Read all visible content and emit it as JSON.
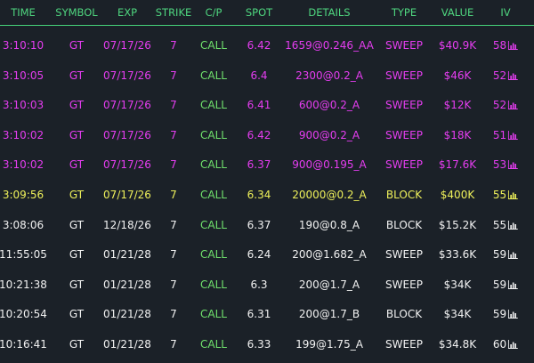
{
  "colors": {
    "background": "#1b2128",
    "header_text": "#4fd67f",
    "header_line": "#46d37a",
    "sweep_magenta": "#e53df0",
    "block_yellow": "#eef05a",
    "call_green": "#6fe06c",
    "white": "#f2f2f2"
  },
  "headers": [
    "TIME",
    "SYMBOL",
    "EXP",
    "STRIKE",
    "C/P",
    "SPOT",
    "DETAILS",
    "TYPE",
    "VALUE",
    "IV"
  ],
  "rows": [
    {
      "time": "3:10:10",
      "symbol": "GT",
      "exp": "07/17/26",
      "strike": "7",
      "cp": "CALL",
      "spot": "6.42",
      "details": "1659@0.246_AA",
      "type": "SWEEP",
      "value": "$40.9K",
      "iv": "58",
      "color": "magenta"
    },
    {
      "time": "3:10:05",
      "symbol": "GT",
      "exp": "07/17/26",
      "strike": "7",
      "cp": "CALL",
      "spot": "6.4",
      "details": "2300@0.2_A",
      "type": "SWEEP",
      "value": "$46K",
      "iv": "52",
      "color": "magenta"
    },
    {
      "time": "3:10:03",
      "symbol": "GT",
      "exp": "07/17/26",
      "strike": "7",
      "cp": "CALL",
      "spot": "6.41",
      "details": "600@0.2_A",
      "type": "SWEEP",
      "value": "$12K",
      "iv": "52",
      "color": "magenta"
    },
    {
      "time": "3:10:02",
      "symbol": "GT",
      "exp": "07/17/26",
      "strike": "7",
      "cp": "CALL",
      "spot": "6.42",
      "details": "900@0.2_A",
      "type": "SWEEP",
      "value": "$18K",
      "iv": "51",
      "color": "magenta"
    },
    {
      "time": "3:10:02",
      "symbol": "GT",
      "exp": "07/17/26",
      "strike": "7",
      "cp": "CALL",
      "spot": "6.37",
      "details": "900@0.195_A",
      "type": "SWEEP",
      "value": "$17.6K",
      "iv": "53",
      "color": "magenta"
    },
    {
      "time": "3:09:56",
      "symbol": "GT",
      "exp": "07/17/26",
      "strike": "7",
      "cp": "CALL",
      "spot": "6.34",
      "details": "20000@0.2_A",
      "type": "BLOCK",
      "value": "$400K",
      "iv": "55",
      "color": "yellow"
    },
    {
      "time": "3:08:06",
      "symbol": "GT",
      "exp": "12/18/26",
      "strike": "7",
      "cp": "CALL",
      "spot": "6.37",
      "details": "190@0.8_A",
      "type": "BLOCK",
      "value": "$15.2K",
      "iv": "55",
      "color": "white"
    },
    {
      "time": "11:55:05",
      "symbol": "GT",
      "exp": "01/21/28",
      "strike": "7",
      "cp": "CALL",
      "spot": "6.24",
      "details": "200@1.682_A",
      "type": "SWEEP",
      "value": "$33.6K",
      "iv": "59",
      "color": "white"
    },
    {
      "time": "10:21:38",
      "symbol": "GT",
      "exp": "01/21/28",
      "strike": "7",
      "cp": "CALL",
      "spot": "6.3",
      "details": "200@1.7_A",
      "type": "SWEEP",
      "value": "$34K",
      "iv": "59",
      "color": "white"
    },
    {
      "time": "10:20:54",
      "symbol": "GT",
      "exp": "01/21/28",
      "strike": "7",
      "cp": "CALL",
      "spot": "6.31",
      "details": "200@1.7_B",
      "type": "BLOCK",
      "value": "$34K",
      "iv": "59",
      "color": "white"
    },
    {
      "time": "10:16:41",
      "symbol": "GT",
      "exp": "01/21/28",
      "strike": "7",
      "cp": "CALL",
      "spot": "6.33",
      "details": "199@1.75_A",
      "type": "SWEEP",
      "value": "$34.8K",
      "iv": "60",
      "color": "white"
    }
  ],
  "iv_icon": "bar-chart-icon"
}
